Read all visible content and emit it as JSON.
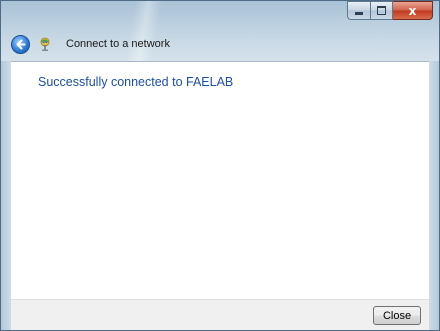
{
  "window": {
    "title": "Connect to a network",
    "controls": {
      "minimize_icon": "minimize-icon",
      "maximize_icon": "maximize-icon",
      "close_icon": "close-icon",
      "close_glyph": "x"
    },
    "nav": {
      "back_icon": "back-arrow-icon",
      "network_icon": "network-icon"
    }
  },
  "content": {
    "message": "Successfully connected to FAELAB"
  },
  "footer": {
    "close_label": "Close"
  },
  "colors": {
    "message_text": "#1f4fa2",
    "close_control": "#c0391f",
    "back_button": "#2f7ed8"
  }
}
